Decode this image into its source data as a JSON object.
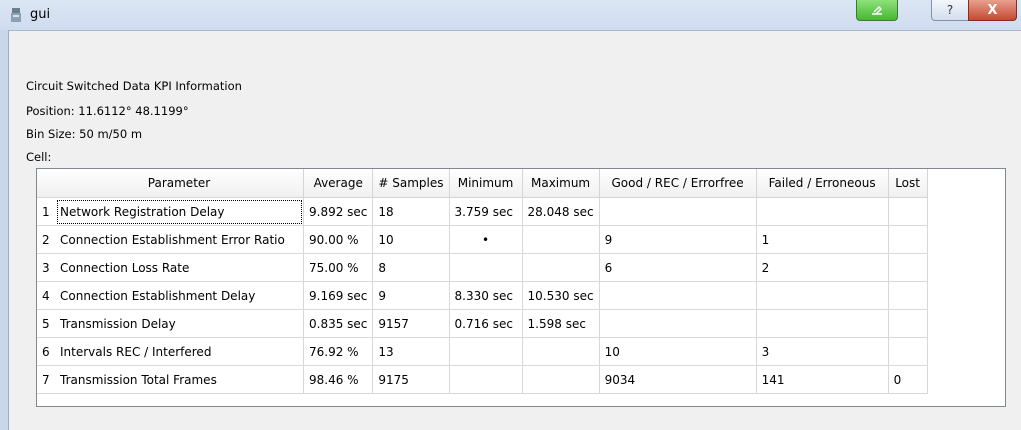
{
  "window": {
    "title": "gui",
    "buttons": {
      "help": "?",
      "close": "X"
    }
  },
  "info": {
    "heading": "Circuit Switched Data KPI Information",
    "position": "Position: 11.6112° 48.1199°",
    "bin_size": "Bin Size: 50 m/50 m",
    "cell": "Cell:"
  },
  "table": {
    "headers": [
      "Parameter",
      "Average",
      "# Samples",
      "Minimum",
      "Maximum",
      "Good / REC / Errorfree",
      "Failed / Erroneous",
      "Lost"
    ],
    "rows": [
      {
        "num": "1",
        "parameter": "Network Registration Delay",
        "average": "9.892 sec",
        "samples": "18",
        "minimum": "3.759 sec",
        "maximum": "28.048 sec",
        "good": "",
        "failed": "",
        "lost": ""
      },
      {
        "num": "2",
        "parameter": "Connection Establishment Error Ratio",
        "average": "90.00 %",
        "samples": "10",
        "minimum": "•",
        "maximum": "",
        "good": "9",
        "failed": "1",
        "lost": ""
      },
      {
        "num": "3",
        "parameter": "Connection Loss Rate",
        "average": "75.00 %",
        "samples": "8",
        "minimum": "",
        "maximum": "",
        "good": "6",
        "failed": "2",
        "lost": ""
      },
      {
        "num": "4",
        "parameter": "Connection Establishment Delay",
        "average": "9.169 sec",
        "samples": "9",
        "minimum": "8.330 sec",
        "maximum": "10.530 sec",
        "good": "",
        "failed": "",
        "lost": ""
      },
      {
        "num": "5",
        "parameter": "Transmission Delay",
        "average": "0.835 sec",
        "samples": "9157",
        "minimum": "0.716 sec",
        "maximum": "1.598 sec",
        "good": "",
        "failed": "",
        "lost": ""
      },
      {
        "num": "6",
        "parameter": "Intervals REC / Interfered",
        "average": "76.92 %",
        "samples": "13",
        "minimum": "",
        "maximum": "",
        "good": "10",
        "failed": "3",
        "lost": ""
      },
      {
        "num": "7",
        "parameter": "Transmission Total Frames",
        "average": "98.46 %",
        "samples": "9175",
        "minimum": "",
        "maximum": "",
        "good": "9034",
        "failed": "141",
        "lost": "0"
      }
    ]
  }
}
